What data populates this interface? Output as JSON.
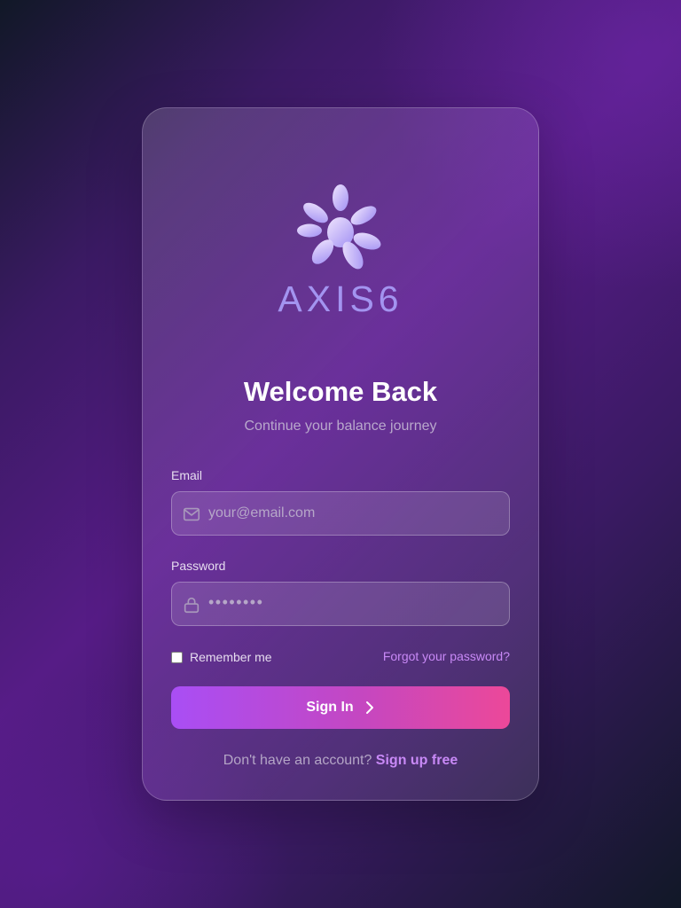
{
  "brand": {
    "name": "AXIS6",
    "colors": {
      "logo_light": "#e4d6fb",
      "logo_dark": "#a594f4",
      "wordmark": "#a394f0"
    }
  },
  "header": {
    "title": "Welcome Back",
    "subtitle": "Continue your balance journey"
  },
  "form": {
    "email": {
      "label": "Email",
      "placeholder": "your@email.com",
      "icon": "mail-icon"
    },
    "password": {
      "label": "Password",
      "value_masked": "••••••••",
      "icon": "lock-icon"
    },
    "remember": {
      "label": "Remember me",
      "checked": false
    },
    "forgot_link": "Forgot your password?",
    "submit": {
      "label": "Sign In",
      "icon": "chevron-right-icon"
    }
  },
  "footer": {
    "prompt": "Don't have an account?",
    "signup_link": "Sign up free"
  },
  "colors": {
    "accent_start": "#a94ef5",
    "accent_end": "#ec4899",
    "link": "#c889f6"
  }
}
